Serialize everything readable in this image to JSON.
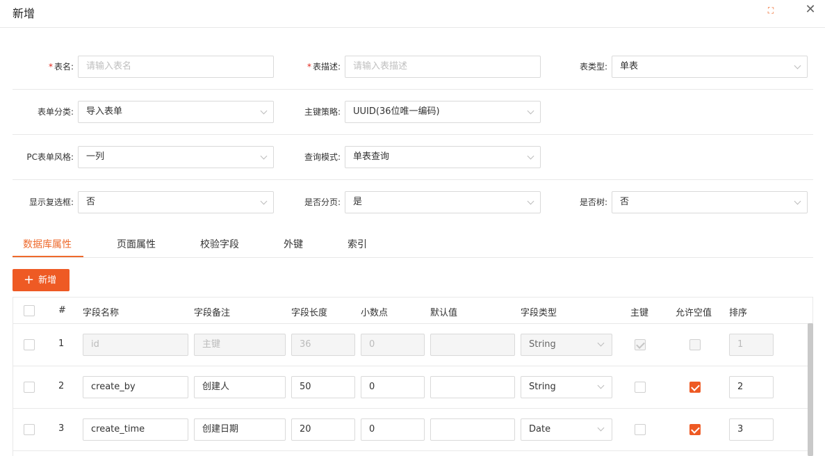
{
  "dialog": {
    "title": "新增"
  },
  "form": {
    "table_name": {
      "label": "表名:",
      "placeholder": "请输入表名"
    },
    "table_desc": {
      "label": "表描述:",
      "placeholder": "请输入表描述"
    },
    "table_type": {
      "label": "表类型:",
      "value": "单表"
    },
    "form_category": {
      "label": "表单分类:",
      "value": "导入表单"
    },
    "pk_strategy": {
      "label": "主键策略:",
      "value": "UUID(36位唯一编码)"
    },
    "pc_style": {
      "label": "PC表单风格:",
      "value": "一列"
    },
    "query_mode": {
      "label": "查询模式:",
      "value": "单表查询"
    },
    "show_checkbox": {
      "label": "显示复选框:",
      "value": "否"
    },
    "paginate": {
      "label": "是否分页:",
      "value": "是"
    },
    "is_tree": {
      "label": "是否树:",
      "value": "否"
    }
  },
  "tabs": [
    {
      "label": "数据库属性",
      "active": true
    },
    {
      "label": "页面属性"
    },
    {
      "label": "校验字段"
    },
    {
      "label": "外键"
    },
    {
      "label": "索引"
    }
  ],
  "add_button": {
    "label": "新增"
  },
  "grid": {
    "columns": [
      "#",
      "字段名称",
      "字段备注",
      "字段长度",
      "小数点",
      "默认值",
      "字段类型",
      "主键",
      "允许空值",
      "排序"
    ],
    "rows": [
      {
        "num": "1",
        "name": "id",
        "remark": "主键",
        "length": "36",
        "decimal": "0",
        "default": "",
        "type": "String",
        "pk": true,
        "nullable": false,
        "order": "1",
        "disabled": true
      },
      {
        "num": "2",
        "name": "create_by",
        "remark": "创建人",
        "length": "50",
        "decimal": "0",
        "default": "",
        "type": "String",
        "pk": false,
        "nullable": true,
        "order": "2",
        "disabled": false
      },
      {
        "num": "3",
        "name": "create_time",
        "remark": "创建日期",
        "length": "20",
        "decimal": "0",
        "default": "",
        "type": "Date",
        "pk": false,
        "nullable": true,
        "order": "3",
        "disabled": false
      }
    ]
  },
  "colors": {
    "accent": "#ee5a24",
    "required": "#e1251b"
  }
}
